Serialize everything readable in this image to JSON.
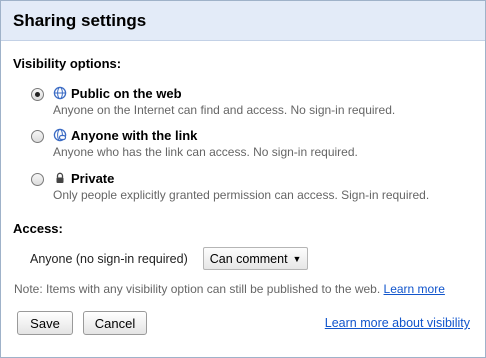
{
  "dialog": {
    "title": "Sharing settings"
  },
  "visibility": {
    "label": "Visibility options:",
    "options": [
      {
        "label": "Public on the web",
        "description": "Anyone on the Internet can find and access. No sign-in required.",
        "icon": "globe-icon",
        "selected": true
      },
      {
        "label": "Anyone with the link",
        "description": "Anyone who has the link can access. No sign-in required.",
        "icon": "link-globe-icon",
        "selected": false
      },
      {
        "label": "Private",
        "description": "Only people explicitly granted permission can access. Sign-in required.",
        "icon": "lock-icon",
        "selected": false
      }
    ]
  },
  "access": {
    "label": "Access:",
    "who": "Anyone (no sign-in required)",
    "permission": "Can comment",
    "permission_caret": "▼"
  },
  "note": {
    "text": "Note: Items with any visibility option can still be published to the web.",
    "link": "Learn more"
  },
  "buttons": {
    "save": "Save",
    "cancel": "Cancel"
  },
  "footer_link": "Learn more about visibility",
  "colors": {
    "titlebar_bg": "#e3ebf8",
    "link": "#1155cc",
    "icon_blue": "#3b6bc4"
  }
}
